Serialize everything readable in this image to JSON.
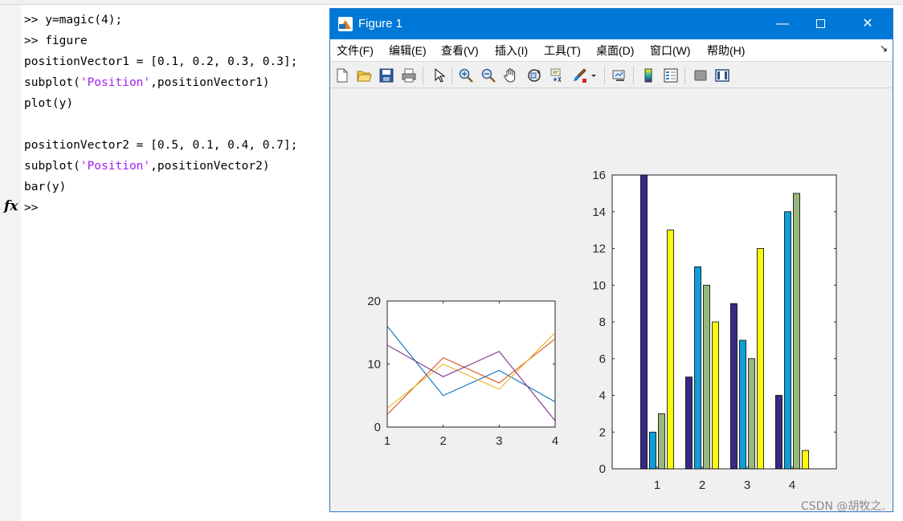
{
  "command_window": {
    "lines": [
      {
        "prompt": ">> ",
        "code": "y=magic(4);"
      },
      {
        "prompt": ">> ",
        "code": "figure"
      },
      {
        "prompt": "",
        "code": "positionVector1 = [0.1, 0.2, 0.3, 0.3];"
      },
      {
        "prompt": "",
        "code": "subplot(",
        "str": "'Position'",
        "tail": ",positionVector1)"
      },
      {
        "prompt": "",
        "code": "plot(y)"
      },
      {
        "prompt": "",
        "code": ""
      },
      {
        "prompt": "",
        "code": "positionVector2 = [0.5, 0.1, 0.4, 0.7];"
      },
      {
        "prompt": "",
        "code": "subplot(",
        "str": "'Position'",
        "tail": ",positionVector2)"
      },
      {
        "prompt": "",
        "code": "bar(y)"
      },
      {
        "prompt": ">> ",
        "code": ""
      }
    ],
    "fx_label": "fx",
    "string_color": "#a020f0"
  },
  "figure_window": {
    "title": "Figure 1",
    "min_glyph": "—",
    "close_glyph": "✕",
    "menu": [
      "文件(F)",
      "编辑(E)",
      "查看(V)",
      "插入(I)",
      "工具(T)",
      "桌面(D)",
      "窗口(W)",
      "帮助(H)"
    ],
    "menu_overflow": "↘",
    "toolbar_icons": [
      "new-figure-icon",
      "open-icon",
      "save-icon",
      "print-icon",
      "pointer-icon",
      "zoom-in-icon",
      "zoom-out-icon",
      "pan-hand-icon",
      "rotate-3d-icon",
      "data-cursor-icon",
      "brush-icon",
      "link-plot-icon",
      "colorbar-icon",
      "legend-icon",
      "hide-plot-tools-icon",
      "show-plot-tools-icon"
    ]
  },
  "watermark": "CSDN @胡牧之.",
  "chart_data": [
    {
      "type": "line",
      "x": [
        1,
        2,
        3,
        4
      ],
      "series": [
        {
          "values": [
            16,
            5,
            9,
            4
          ],
          "color": "#0072bd"
        },
        {
          "values": [
            2,
            11,
            7,
            14
          ],
          "color": "#d95319"
        },
        {
          "values": [
            3,
            10,
            6,
            15
          ],
          "color": "#edb120"
        },
        {
          "values": [
            13,
            8,
            12,
            1
          ],
          "color": "#7e2f8e"
        }
      ],
      "xlim": [
        1,
        4
      ],
      "ylim": [
        0,
        20
      ],
      "xticks": [
        1,
        2,
        3,
        4
      ],
      "yticks": [
        0,
        10,
        20
      ],
      "grid": false
    },
    {
      "type": "bar",
      "categories": [
        "1",
        "2",
        "3",
        "4"
      ],
      "series": [
        {
          "values": [
            16,
            5,
            9,
            4
          ],
          "color": "#352a87"
        },
        {
          "values": [
            2,
            11,
            7,
            14
          ],
          "color": "#0f9fd8"
        },
        {
          "values": [
            3,
            10,
            6,
            15
          ],
          "color": "#98b77c"
        },
        {
          "values": [
            13,
            8,
            12,
            1
          ],
          "color": "#f9fb0e"
        }
      ],
      "ylim": [
        0,
        16
      ],
      "yticks": [
        0,
        2,
        4,
        6,
        8,
        10,
        12,
        14,
        16
      ],
      "grid": false
    }
  ]
}
